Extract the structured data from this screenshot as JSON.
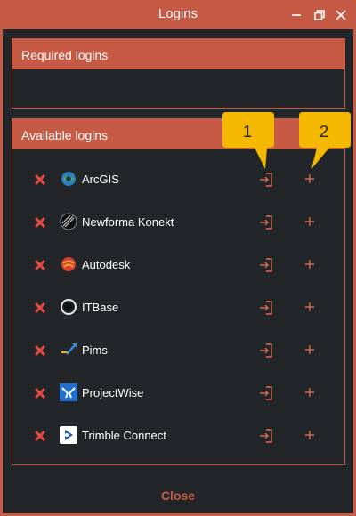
{
  "window": {
    "title": "Logins",
    "accent_color": "#c65a44",
    "background_color": "#222629"
  },
  "required_section": {
    "title": "Required logins",
    "items": []
  },
  "available_section": {
    "title": "Available logins",
    "items": [
      {
        "name": "ArcGIS",
        "icon": "arcgis-icon"
      },
      {
        "name": "Newforma Konekt",
        "icon": "newforma-konekt-icon"
      },
      {
        "name": "Autodesk",
        "icon": "autodesk-icon"
      },
      {
        "name": "ITBase",
        "icon": "itbase-icon"
      },
      {
        "name": "Pims",
        "icon": "pims-icon"
      },
      {
        "name": "ProjectWise",
        "icon": "projectwise-icon"
      },
      {
        "name": "Trimble Connect",
        "icon": "trimble-connect-icon"
      }
    ]
  },
  "footer": {
    "close_label": "Close"
  },
  "callouts": [
    {
      "label": "1",
      "color": "#f5b800"
    },
    {
      "label": "2",
      "color": "#f5b800"
    }
  ]
}
